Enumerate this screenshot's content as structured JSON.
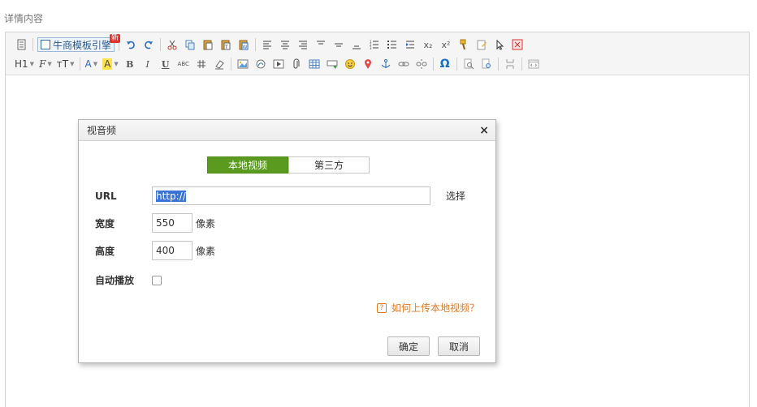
{
  "section_label": "详情内容",
  "toolbar": {
    "template_label": "牛商模板引擎",
    "new_badge": "新",
    "heading_label": "H1",
    "font_family_label": "F",
    "font_size_label": "тT",
    "font_color_label": "A",
    "highlight_label": "A",
    "bold_label": "B",
    "italic_label": "I",
    "underline_label": "U",
    "strike_label": "ABC",
    "subscript_label": "x₂",
    "superscript_label": "x²",
    "special_chars_label": "Ω"
  },
  "dialog": {
    "title": "视音频",
    "close_label": "×",
    "tabs": [
      {
        "label": "本地视频",
        "active": true
      },
      {
        "label": "第三方",
        "active": false
      }
    ],
    "url_label": "URL",
    "url_value": "http://",
    "choose_label": "选择",
    "width_label": "宽度",
    "width_value": "550",
    "height_label": "高度",
    "height_value": "400",
    "unit_label": "像素",
    "autoplay_label": "自动播放",
    "help_link": "如何上传本地视频？",
    "help_icon": "?",
    "ok_label": "确定",
    "cancel_label": "取消"
  },
  "colors": {
    "active_tab": "#5a9a1e",
    "help_link": "#e27a26",
    "selection": "#3b73d6"
  }
}
